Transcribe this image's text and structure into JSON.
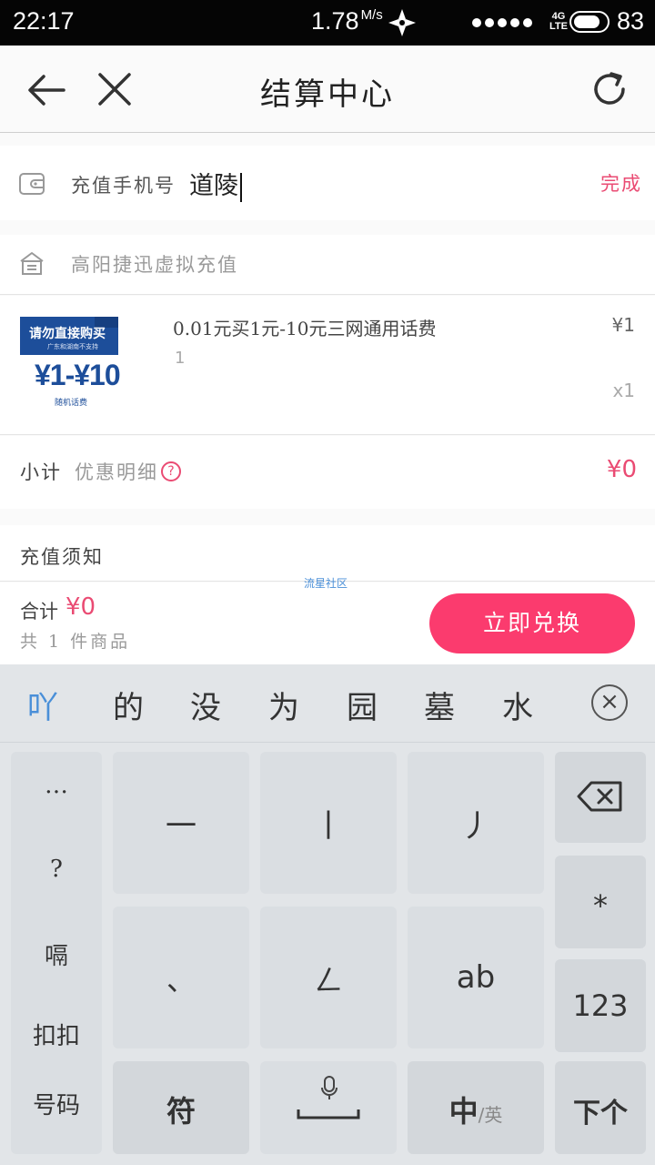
{
  "status_bar": {
    "time": "22:17",
    "speed": "1.78",
    "speed_unit": "M/s",
    "network": "4G",
    "network_sub": "LTE",
    "battery": "83",
    "battery_level_percent": 83
  },
  "header": {
    "title": "结算中心"
  },
  "phone": {
    "label": "充值手机号",
    "value": "道陵",
    "done": "完成"
  },
  "store": {
    "name": "高阳捷迅虚拟充值"
  },
  "product": {
    "image_text_main": "请勿直接购买",
    "image_text_sub": "广东和湖南不支持",
    "image_price": "¥1-¥10",
    "image_caption": "随机话费",
    "name": "0.01元买1元-10元三网通用话费",
    "spec": "1",
    "price": "¥1",
    "quantity": "x1"
  },
  "subtotal": {
    "label": "小计",
    "detail": "优惠明细",
    "help": "?",
    "amount": "¥0"
  },
  "notice": {
    "label": "充值须知"
  },
  "watermark": "流星社区",
  "footer": {
    "total_label": "合计",
    "total_amount": "¥0",
    "count": "共 1 件商品",
    "redeem_button": "立即兑换"
  },
  "keyboard": {
    "pinyin": "吖",
    "candidates": [
      "的",
      "没",
      "为",
      "园",
      "墓",
      "水"
    ],
    "close": "×",
    "left_column": [
      "…",
      "?",
      "嗝",
      "扣扣",
      "号码"
    ],
    "keys": {
      "heng": "一",
      "shu": "丨",
      "pie": "丿",
      "dian": "、",
      "zhe": "ㄥ",
      "ab": "ab",
      "star": "*",
      "num": "123",
      "symbol": "符",
      "lang_main": "中",
      "lang_sub": "/英",
      "next": "下个"
    }
  }
}
